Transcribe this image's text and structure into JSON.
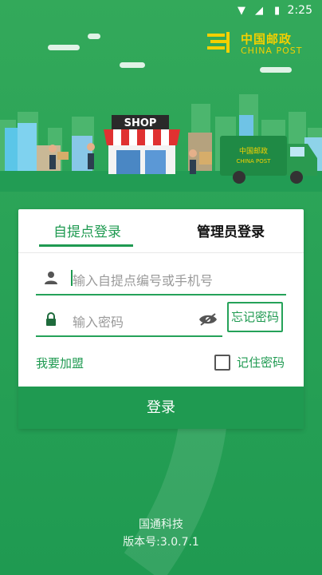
{
  "status_bar": {
    "time": "2:25"
  },
  "logo": {
    "cn": "中国邮政",
    "en": "CHINA POST"
  },
  "scene": {
    "shop_sign": "SHOP",
    "truck_logo_cn": "中国邮政",
    "truck_logo_en": "CHINA POST"
  },
  "tabs": {
    "pickup_login": "自提点登录",
    "admin_login": "管理员登录"
  },
  "form": {
    "account_placeholder": "输入自提点编号或手机号",
    "password_placeholder": "输入密码",
    "forgot_password": "忘记密码",
    "join": "我要加盟",
    "remember_password": "记住密码",
    "remember_checked": false,
    "login_button": "登录"
  },
  "footer": {
    "company": "国通科技",
    "version": "版本号:3.0.7.1"
  },
  "colors": {
    "brand_green": "#1f9a51",
    "logo_yellow": "#f4d000"
  }
}
